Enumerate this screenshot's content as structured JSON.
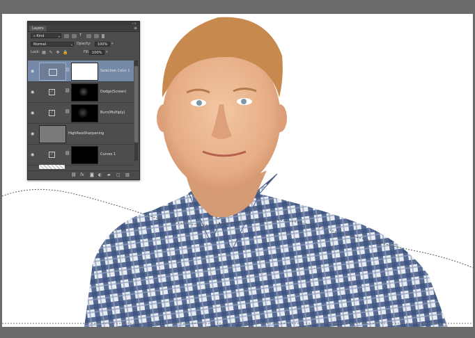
{
  "panel": {
    "tab_label": "Layers",
    "filter_value": "Kind",
    "blend_mode": "Normal",
    "opacity_label": "Opacity:",
    "opacity_value": "100%",
    "lock_label": "Lock:",
    "fill_label": "Fill:",
    "fill_value": "100%",
    "layers": [
      {
        "name": "Selection Color 1",
        "selected": true
      },
      {
        "name": "Dodge(Screen)",
        "selected": false
      },
      {
        "name": "Burn(Multiply)",
        "selected": false
      },
      {
        "name": "HighPassSharpening",
        "selected": false
      },
      {
        "name": "Curves 1",
        "selected": false
      }
    ],
    "bottom_icons": [
      "link-icon",
      "fx-icon",
      "mask-icon",
      "adjustment-icon",
      "folder-icon",
      "new-layer-icon",
      "trash-icon"
    ]
  },
  "colors": {
    "workspace": "#6b6b6b",
    "panel_bg": "#4d4d4d",
    "selected_layer": "#7589a8",
    "shirt_blue": "#3d5480"
  }
}
